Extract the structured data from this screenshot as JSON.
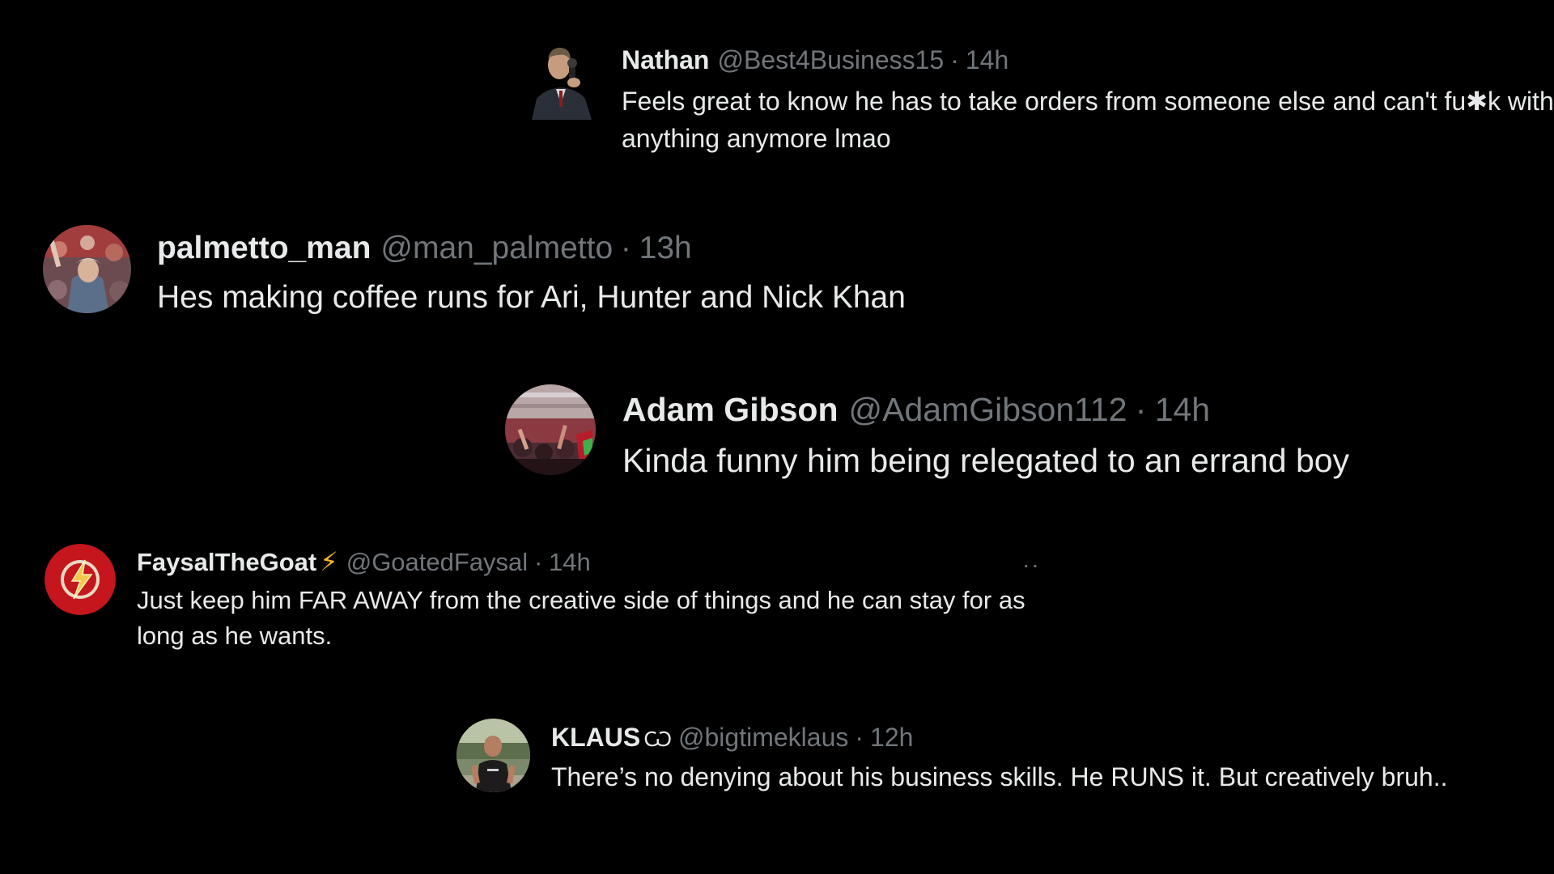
{
  "tweets": [
    {
      "name": "Nathan",
      "handle": "@Best4Business15",
      "separator": "·",
      "time": "14h",
      "text": "Feels great to know he has to take orders from someone else and can't fu✱k with anything anymore lmao",
      "avatar": "avatar-man-suit-microphone"
    },
    {
      "name": "palmetto_man",
      "handle": "@man_palmetto",
      "separator": "·",
      "time": "13h",
      "text": "Hes making coffee runs for Ari, Hunter and Nick Khan",
      "avatar": "avatar-crowd-cheering"
    },
    {
      "name": "Adam Gibson",
      "handle": "@AdamGibson112",
      "separator": "·",
      "time": "14h",
      "text": "Kinda funny him being relegated to an errand boy",
      "avatar": "avatar-stadium-crowd"
    },
    {
      "name": "FaysalTheGoat",
      "name_badge": "⚡",
      "handle": "@GoatedFaysal",
      "separator": "·",
      "time": "14h",
      "text": "Just keep him FAR AWAY from the creative side of things and he can stay for as long as he wants.",
      "more": "··",
      "avatar": "avatar-flash-logo"
    },
    {
      "name": "KLAUS",
      "name_badge": "Ѡ",
      "handle": "@bigtimeklaus",
      "separator": "·",
      "time": "12h",
      "text": "There’s no denying about his business skills. He RUNS it. But creatively bruh..",
      "avatar": "avatar-man-outdoors"
    }
  ],
  "colors": {
    "background": "#000000",
    "name": "#e7e9ea",
    "muted": "#71767b",
    "text": "#e7e9ea",
    "bolt": "#f5b72c",
    "flash_red": "#c4161c"
  }
}
